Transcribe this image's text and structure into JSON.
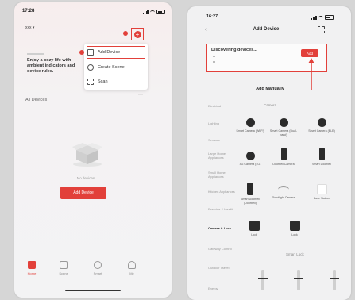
{
  "colors": {
    "accent": "#e2403a",
    "dark_icon": "#2b2b2b",
    "muted_text": "#9a9a9a"
  },
  "left_screen": {
    "status_time": "17:28",
    "home_name": "xxx ▾",
    "menu": {
      "items": [
        {
          "label": "Add Device",
          "icon": "add-device-icon"
        },
        {
          "label": "Create Scene",
          "icon": "scene-icon"
        },
        {
          "label": "Scan",
          "icon": "scan-icon"
        }
      ]
    },
    "banner_text": "Enjoy a cozy life with ambient indicators and device rules.",
    "section_title": "All Devices",
    "more_label": "···",
    "empty_text": "No devices",
    "add_button": "Add Device",
    "tabs": [
      {
        "label": "Home",
        "icon": "home-icon"
      },
      {
        "label": "Scene",
        "icon": "scene-icon"
      },
      {
        "label": "Smart",
        "icon": "smart-icon"
      },
      {
        "label": "Me",
        "icon": "person-icon"
      }
    ]
  },
  "right_screen": {
    "status_time": "16:27",
    "back_icon": "chevron-left-icon",
    "title": "Add Device",
    "scan_icon": "scan-icon",
    "discovering_text": "Discovering devices...",
    "add_label": "Add",
    "add_manually": "Add Manually",
    "categories": [
      "Electrical",
      "Lighting",
      "Sensors",
      "Large Home Appliances",
      "Small Home Appliances",
      "Kitchen Appliances",
      "Exercise & Health",
      "Camera & Lock",
      "Gateway Control",
      "Outdoor Travel",
      "Energy"
    ],
    "selected_category": "Camera & Lock",
    "camera_header": "Camera",
    "camera_items": [
      {
        "label": "Smart Camera (Wi-Fi)",
        "icon": "dome-camera-icon"
      },
      {
        "label": "Smart Camera (Dual-band)",
        "icon": "dome-camera-icon"
      },
      {
        "label": "Smart Camera (BLE)",
        "icon": "dome-camera-icon"
      },
      {
        "label": "4G Camera (4G)",
        "icon": "dome-camera-icon"
      },
      {
        "label": "Doorbell Camera",
        "icon": "doorbell-icon"
      },
      {
        "label": "Smart Doorbell",
        "icon": "doorbell-icon"
      },
      {
        "label": "Smart Doorbell (Doorbell)",
        "icon": "doorbell-icon"
      },
      {
        "label": "Floodlight Camera",
        "icon": "floodlight-icon"
      },
      {
        "label": "Base Station",
        "icon": "base-station-icon"
      }
    ],
    "lock_items": [
      {
        "label": "Lock",
        "icon": "lock-icon"
      },
      {
        "label": "Lock",
        "icon": "lock-icon"
      }
    ],
    "smart_lock_header": "Smart Lock"
  }
}
